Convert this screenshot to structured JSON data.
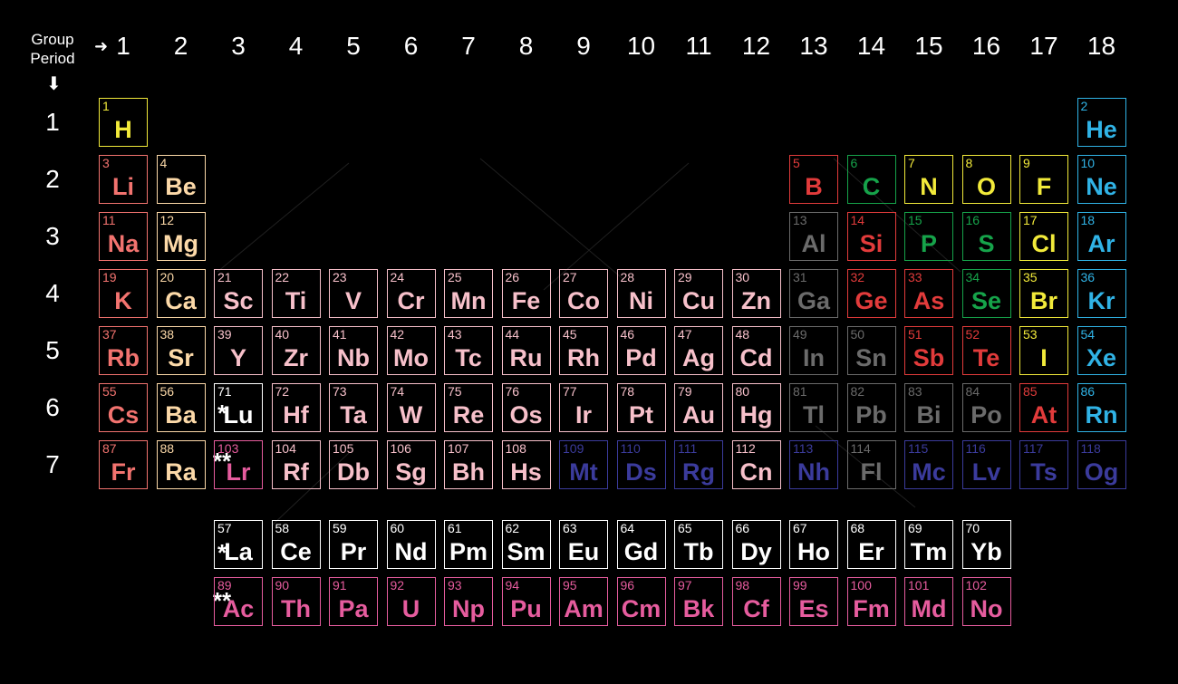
{
  "corner": {
    "group_label": "Group",
    "period_label": "Period",
    "arrow_right": "➜",
    "arrow_down": "⬇"
  },
  "groups": [
    "1",
    "2",
    "3",
    "4",
    "5",
    "6",
    "7",
    "8",
    "9",
    "10",
    "11",
    "12",
    "13",
    "14",
    "15",
    "16",
    "17",
    "18"
  ],
  "periods": [
    "1",
    "2",
    "3",
    "4",
    "5",
    "6",
    "7"
  ],
  "markers": {
    "lanthanide": "*",
    "actinide": "**"
  },
  "categories": {
    "nonmetal": "#f2ea3a",
    "alkali": "#f2736f",
    "alkaline": "#fcd9a8",
    "transition": "#f7c0ca",
    "metalloid_red": "#e23b3b",
    "green": "#16a34a",
    "noble": "#30b3e6",
    "poor": "#6b6b6b",
    "unknown": "#3b3b9c",
    "lanthanide": "#ffffff",
    "actinide": "#e65c9e"
  },
  "elements": [
    [
      "1",
      "H",
      1,
      1,
      "nonmetal"
    ],
    [
      "2",
      "He",
      18,
      1,
      "noble"
    ],
    [
      "3",
      "Li",
      1,
      2,
      "alkali"
    ],
    [
      "4",
      "Be",
      2,
      2,
      "alkaline"
    ],
    [
      "5",
      "B",
      13,
      2,
      "metalloid_red"
    ],
    [
      "6",
      "C",
      14,
      2,
      "green"
    ],
    [
      "7",
      "N",
      15,
      2,
      "nonmetal"
    ],
    [
      "8",
      "O",
      16,
      2,
      "nonmetal"
    ],
    [
      "9",
      "F",
      17,
      2,
      "nonmetal"
    ],
    [
      "10",
      "Ne",
      18,
      2,
      "noble"
    ],
    [
      "11",
      "Na",
      1,
      3,
      "alkali"
    ],
    [
      "12",
      "Mg",
      2,
      3,
      "alkaline"
    ],
    [
      "13",
      "Al",
      13,
      3,
      "poor"
    ],
    [
      "14",
      "Si",
      14,
      3,
      "metalloid_red"
    ],
    [
      "15",
      "P",
      15,
      3,
      "green"
    ],
    [
      "16",
      "S",
      16,
      3,
      "green"
    ],
    [
      "17",
      "Cl",
      17,
      3,
      "nonmetal"
    ],
    [
      "18",
      "Ar",
      18,
      3,
      "noble"
    ],
    [
      "19",
      "K",
      1,
      4,
      "alkali"
    ],
    [
      "20",
      "Ca",
      2,
      4,
      "alkaline"
    ],
    [
      "21",
      "Sc",
      3,
      4,
      "transition"
    ],
    [
      "22",
      "Ti",
      4,
      4,
      "transition"
    ],
    [
      "23",
      "V",
      5,
      4,
      "transition"
    ],
    [
      "24",
      "Cr",
      6,
      4,
      "transition"
    ],
    [
      "25",
      "Mn",
      7,
      4,
      "transition"
    ],
    [
      "26",
      "Fe",
      8,
      4,
      "transition"
    ],
    [
      "27",
      "Co",
      9,
      4,
      "transition"
    ],
    [
      "28",
      "Ni",
      10,
      4,
      "transition"
    ],
    [
      "29",
      "Cu",
      11,
      4,
      "transition"
    ],
    [
      "30",
      "Zn",
      12,
      4,
      "transition"
    ],
    [
      "31",
      "Ga",
      13,
      4,
      "poor"
    ],
    [
      "32",
      "Ge",
      14,
      4,
      "metalloid_red"
    ],
    [
      "33",
      "As",
      15,
      4,
      "metalloid_red"
    ],
    [
      "34",
      "Se",
      16,
      4,
      "green"
    ],
    [
      "35",
      "Br",
      17,
      4,
      "nonmetal"
    ],
    [
      "36",
      "Kr",
      18,
      4,
      "noble"
    ],
    [
      "37",
      "Rb",
      1,
      5,
      "alkali"
    ],
    [
      "38",
      "Sr",
      2,
      5,
      "alkaline"
    ],
    [
      "39",
      "Y",
      3,
      5,
      "transition"
    ],
    [
      "40",
      "Zr",
      4,
      5,
      "transition"
    ],
    [
      "41",
      "Nb",
      5,
      5,
      "transition"
    ],
    [
      "42",
      "Mo",
      6,
      5,
      "transition"
    ],
    [
      "43",
      "Tc",
      7,
      5,
      "transition"
    ],
    [
      "44",
      "Ru",
      8,
      5,
      "transition"
    ],
    [
      "45",
      "Rh",
      9,
      5,
      "transition"
    ],
    [
      "46",
      "Pd",
      10,
      5,
      "transition"
    ],
    [
      "47",
      "Ag",
      11,
      5,
      "transition"
    ],
    [
      "48",
      "Cd",
      12,
      5,
      "transition"
    ],
    [
      "49",
      "In",
      13,
      5,
      "poor"
    ],
    [
      "50",
      "Sn",
      14,
      5,
      "poor"
    ],
    [
      "51",
      "Sb",
      15,
      5,
      "metalloid_red"
    ],
    [
      "52",
      "Te",
      16,
      5,
      "metalloid_red"
    ],
    [
      "53",
      "I",
      17,
      5,
      "nonmetal"
    ],
    [
      "54",
      "Xe",
      18,
      5,
      "noble"
    ],
    [
      "55",
      "Cs",
      1,
      6,
      "alkali"
    ],
    [
      "56",
      "Ba",
      2,
      6,
      "alkaline"
    ],
    [
      "71",
      "Lu",
      3,
      6,
      "lanthanide"
    ],
    [
      "72",
      "Hf",
      4,
      6,
      "transition"
    ],
    [
      "73",
      "Ta",
      5,
      6,
      "transition"
    ],
    [
      "74",
      "W",
      6,
      6,
      "transition"
    ],
    [
      "75",
      "Re",
      7,
      6,
      "transition"
    ],
    [
      "76",
      "Os",
      8,
      6,
      "transition"
    ],
    [
      "77",
      "Ir",
      9,
      6,
      "transition"
    ],
    [
      "78",
      "Pt",
      10,
      6,
      "transition"
    ],
    [
      "79",
      "Au",
      11,
      6,
      "transition"
    ],
    [
      "80",
      "Hg",
      12,
      6,
      "transition"
    ],
    [
      "81",
      "Tl",
      13,
      6,
      "poor"
    ],
    [
      "82",
      "Pb",
      14,
      6,
      "poor"
    ],
    [
      "83",
      "Bi",
      15,
      6,
      "poor"
    ],
    [
      "84",
      "Po",
      16,
      6,
      "poor"
    ],
    [
      "85",
      "At",
      17,
      6,
      "metalloid_red"
    ],
    [
      "86",
      "Rn",
      18,
      6,
      "noble"
    ],
    [
      "87",
      "Fr",
      1,
      7,
      "alkali"
    ],
    [
      "88",
      "Ra",
      2,
      7,
      "alkaline"
    ],
    [
      "103",
      "Lr",
      3,
      7,
      "actinide"
    ],
    [
      "104",
      "Rf",
      4,
      7,
      "transition"
    ],
    [
      "105",
      "Db",
      5,
      7,
      "transition"
    ],
    [
      "106",
      "Sg",
      6,
      7,
      "transition"
    ],
    [
      "107",
      "Bh",
      7,
      7,
      "transition"
    ],
    [
      "108",
      "Hs",
      8,
      7,
      "transition"
    ],
    [
      "109",
      "Mt",
      9,
      7,
      "unknown"
    ],
    [
      "110",
      "Ds",
      10,
      7,
      "unknown"
    ],
    [
      "111",
      "Rg",
      11,
      7,
      "unknown"
    ],
    [
      "112",
      "Cn",
      12,
      7,
      "transition"
    ],
    [
      "113",
      "Nh",
      13,
      7,
      "unknown"
    ],
    [
      "114",
      "Fl",
      14,
      7,
      "poor"
    ],
    [
      "115",
      "Mc",
      15,
      7,
      "unknown"
    ],
    [
      "116",
      "Lv",
      16,
      7,
      "unknown"
    ],
    [
      "117",
      "Ts",
      17,
      7,
      "unknown"
    ],
    [
      "118",
      "Og",
      18,
      7,
      "unknown"
    ],
    [
      "57",
      "La",
      3,
      8,
      "lanthanide"
    ],
    [
      "58",
      "Ce",
      4,
      8,
      "lanthanide"
    ],
    [
      "59",
      "Pr",
      5,
      8,
      "lanthanide"
    ],
    [
      "60",
      "Nd",
      6,
      8,
      "lanthanide"
    ],
    [
      "61",
      "Pm",
      7,
      8,
      "lanthanide"
    ],
    [
      "62",
      "Sm",
      8,
      8,
      "lanthanide"
    ],
    [
      "63",
      "Eu",
      9,
      8,
      "lanthanide"
    ],
    [
      "64",
      "Gd",
      10,
      8,
      "lanthanide"
    ],
    [
      "65",
      "Tb",
      11,
      8,
      "lanthanide"
    ],
    [
      "66",
      "Dy",
      12,
      8,
      "lanthanide"
    ],
    [
      "67",
      "Ho",
      13,
      8,
      "lanthanide"
    ],
    [
      "68",
      "Er",
      14,
      8,
      "lanthanide"
    ],
    [
      "69",
      "Tm",
      15,
      8,
      "lanthanide"
    ],
    [
      "70",
      "Yb",
      16,
      8,
      "lanthanide"
    ],
    [
      "89",
      "Ac",
      3,
      9,
      "actinide"
    ],
    [
      "90",
      "Th",
      4,
      9,
      "actinide"
    ],
    [
      "91",
      "Pa",
      5,
      9,
      "actinide"
    ],
    [
      "92",
      "U",
      6,
      9,
      "actinide"
    ],
    [
      "93",
      "Np",
      7,
      9,
      "actinide"
    ],
    [
      "94",
      "Pu",
      8,
      9,
      "actinide"
    ],
    [
      "95",
      "Am",
      9,
      9,
      "actinide"
    ],
    [
      "96",
      "Cm",
      10,
      9,
      "actinide"
    ],
    [
      "97",
      "Bk",
      11,
      9,
      "actinide"
    ],
    [
      "98",
      "Cf",
      12,
      9,
      "actinide"
    ],
    [
      "99",
      "Es",
      13,
      9,
      "actinide"
    ],
    [
      "100",
      "Fm",
      14,
      9,
      "actinide"
    ],
    [
      "101",
      "Md",
      15,
      9,
      "actinide"
    ],
    [
      "102",
      "No",
      16,
      9,
      "actinide"
    ]
  ]
}
